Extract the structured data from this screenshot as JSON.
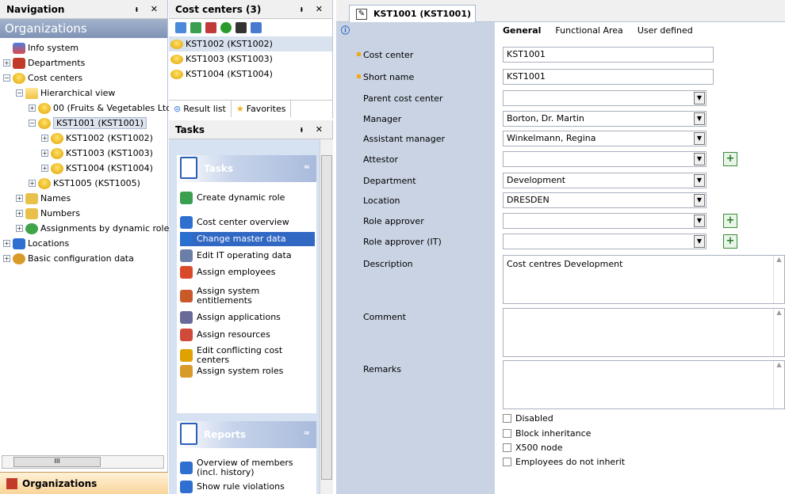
{
  "nav": {
    "title": "Navigation",
    "pin": "↑",
    "close": "×",
    "header": "Organizations",
    "bottom_tab": "Organizations",
    "tree": [
      {
        "label": "Info system",
        "indent": 0,
        "icon": "info",
        "pm": ""
      },
      {
        "label": "Departments",
        "indent": 0,
        "icon": "dept",
        "pm": "+"
      },
      {
        "label": "Cost centers",
        "indent": 0,
        "icon": "coin",
        "pm": "−"
      },
      {
        "label": "Hierarchical view",
        "indent": 1,
        "icon": "folder",
        "pm": "−"
      },
      {
        "label": "00 (Fruits & Vegetables Ltd",
        "indent": 2,
        "icon": "coin",
        "pm": "+"
      },
      {
        "label": "KST1001 (KST1001)",
        "indent": 2,
        "icon": "coin",
        "pm": "−",
        "selected": true
      },
      {
        "label": "KST1002 (KST1002)",
        "indent": 3,
        "icon": "coin",
        "pm": "+"
      },
      {
        "label": "KST1003 (KST1003)",
        "indent": 3,
        "icon": "coin",
        "pm": "+"
      },
      {
        "label": "KST1004 (KST1004)",
        "indent": 3,
        "icon": "coin",
        "pm": "+"
      },
      {
        "label": "KST1005 (KST1005)",
        "indent": 2,
        "icon": "coin",
        "pm": "+"
      },
      {
        "label": "Names",
        "indent": 1,
        "icon": "az",
        "pm": "+"
      },
      {
        "label": "Numbers",
        "indent": 1,
        "icon": "az",
        "pm": "+"
      },
      {
        "label": "Assignments by dynamic role",
        "indent": 1,
        "icon": "green",
        "pm": "+"
      },
      {
        "label": "Locations",
        "indent": 0,
        "icon": "blue",
        "pm": "+"
      },
      {
        "label": "Basic configuration data",
        "indent": 0,
        "icon": "gear",
        "pm": "+"
      }
    ]
  },
  "cost_centers": {
    "title": "Cost centers (3)",
    "items": [
      "KST1002 (KST1002)",
      "KST1003 (KST1003)",
      "KST1004 (KST1004)"
    ],
    "tab_result": "Result list",
    "tab_favorites": "Favorites"
  },
  "tasks": {
    "title": "Tasks",
    "group_tasks": "Tasks",
    "group_reports": "Reports",
    "items": [
      "Create dynamic role",
      "Cost center overview",
      "Change master data",
      "Edit IT operating data",
      "Assign employees",
      "Assign system entitlements",
      "Assign applications",
      "Assign resources",
      "Edit conflicting cost centers",
      "Assign system roles"
    ],
    "reports": [
      "Overview of members (incl. history)",
      "Show rule violations"
    ]
  },
  "detail": {
    "tab": "KST1001 (KST1001)",
    "tabs": [
      "General",
      "Functional Area",
      "User defined"
    ],
    "labels": {
      "cost_center": "Cost center",
      "short_name": "Short name",
      "parent": "Parent cost center",
      "manager": "Manager",
      "assistant": "Assistant manager",
      "attestor": "Attestor",
      "department": "Department",
      "location": "Location",
      "role_approver": "Role approver",
      "role_approver_it": "Role approver (IT)",
      "description": "Description",
      "comment": "Comment",
      "remarks": "Remarks"
    },
    "values": {
      "cost_center": "KST1001",
      "short_name": "KST1001",
      "parent": "",
      "manager": "Borton, Dr. Martin",
      "assistant": "Winkelmann, Regina",
      "attestor": "",
      "department": "Development",
      "location": "DRESDEN",
      "role_approver": "",
      "role_approver_it": "",
      "description": "Cost centres Development",
      "comment": "",
      "remarks": ""
    },
    "checks": [
      "Disabled",
      "Block inheritance",
      "X500 node",
      "Employees do not inherit"
    ]
  }
}
